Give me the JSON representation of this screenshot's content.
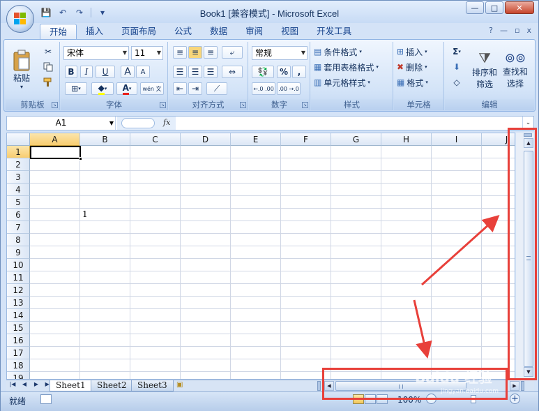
{
  "window": {
    "title": "Book1  [兼容模式] - Microsoft Excel",
    "controls": {
      "minimize": "—",
      "maximize": "□",
      "close": "✕"
    }
  },
  "quick_access": {
    "save": "💾",
    "undo": "↶",
    "redo": "↷",
    "customize": "▾"
  },
  "tabs": [
    "开始",
    "插入",
    "页面布局",
    "公式",
    "数据",
    "审阅",
    "视图",
    "开发工具"
  ],
  "ribbon_right": {
    "help": "?",
    "minimize": "—",
    "restore": "▫",
    "close": "x"
  },
  "ribbon": {
    "clipboard": {
      "title": "剪贴板",
      "paste": "粘贴"
    },
    "font": {
      "title": "字体",
      "name": "宋体",
      "size": "11",
      "bold": "B",
      "italic": "I",
      "underline": "U",
      "grow": "A",
      "shrink": "A",
      "phonetic": "wén 文",
      "font_color": "A"
    },
    "alignment": {
      "title": "对齐方式"
    },
    "number": {
      "title": "数字",
      "format": "常规",
      "percent": "%",
      "comma": ",",
      "inc_decimal": "←.0 .00",
      "dec_decimal": ".00 →.0"
    },
    "styles": {
      "title": "样式",
      "conditional": "条件格式",
      "table": "套用表格格式",
      "cell_styles": "单元格样式"
    },
    "cells": {
      "title": "单元格",
      "insert": "插入",
      "delete": "删除",
      "format": "格式"
    },
    "editing": {
      "title": "编辑",
      "sigma": "Σ",
      "sort_filter_1": "排序和",
      "sort_filter_2": "筛选",
      "find_select_1": "查找和",
      "find_select_2": "选择"
    }
  },
  "formula_bar": {
    "name_box": "A1",
    "fx": "fx",
    "value": ""
  },
  "columns": [
    "A",
    "B",
    "C",
    "D",
    "E",
    "F",
    "G",
    "H",
    "I",
    "J"
  ],
  "rows": [
    "1",
    "2",
    "3",
    "4",
    "5",
    "6",
    "7",
    "8",
    "9",
    "10",
    "11",
    "12",
    "13",
    "14",
    "15",
    "16",
    "17",
    "18",
    "19"
  ],
  "cells": {
    "B6": "1"
  },
  "sheets": [
    "Sheet1",
    "Sheet2",
    "Sheet3"
  ],
  "status": {
    "ready": "就绪",
    "zoom": "100%",
    "zoom_minus": "－",
    "zoom_plus": "+"
  },
  "watermark": {
    "brand": "Baidu 经验",
    "url": "jingyan.baidu.com"
  },
  "annotation_color": "#e8403a"
}
